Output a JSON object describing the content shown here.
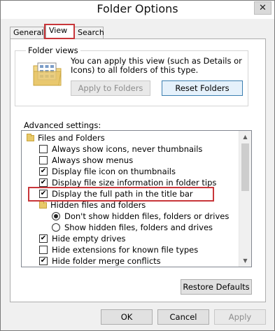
{
  "window": {
    "title": "Folder Options",
    "close_glyph": "✕"
  },
  "tabs": [
    {
      "label": "General"
    },
    {
      "label": "View"
    },
    {
      "label": "Search"
    }
  ],
  "folder_views": {
    "legend": "Folder views",
    "description": "You can apply this view (such as Details or Icons) to all folders of this type.",
    "apply_label": "Apply to Folders",
    "reset_label": "Reset Folders"
  },
  "advanced": {
    "label": "Advanced settings:",
    "items": [
      {
        "text": "Files and Folders"
      },
      {
        "text": "Always show icons, never thumbnails"
      },
      {
        "text": "Always show menus"
      },
      {
        "text": "Display file icon on thumbnails"
      },
      {
        "text": "Display file size information in folder tips"
      },
      {
        "text": "Display the full path in the title bar"
      },
      {
        "text": "Hidden files and folders"
      },
      {
        "text": "Don't show hidden files, folders or drives"
      },
      {
        "text": "Show hidden files, folders and drives"
      },
      {
        "text": "Hide empty drives"
      },
      {
        "text": "Hide extensions for known file types"
      },
      {
        "text": "Hide folder merge conflicts"
      }
    ],
    "check_glyph": "✔",
    "restore_label": "Restore Defaults"
  },
  "footer": {
    "ok_label": "OK",
    "cancel_label": "Cancel",
    "apply_label": "Apply"
  },
  "colors": {
    "highlight": "#c8363a",
    "focus_border": "#3c7fb1"
  }
}
